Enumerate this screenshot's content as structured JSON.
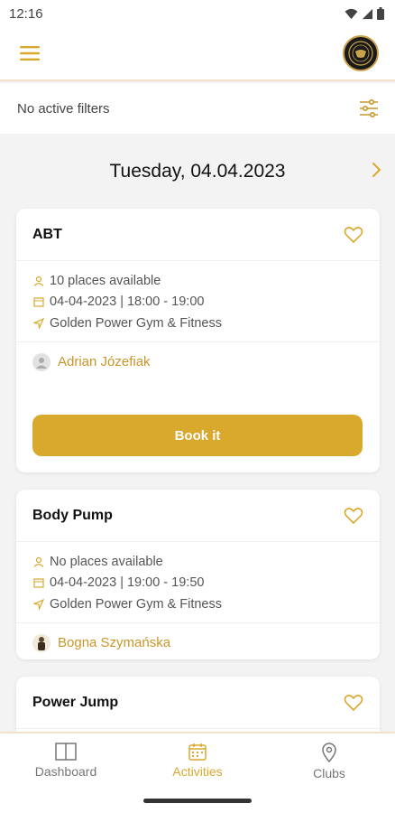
{
  "status": {
    "time": "12:16"
  },
  "filter": {
    "text": "No active filters"
  },
  "date": {
    "label": "Tuesday, 04.04.2023"
  },
  "activities": [
    {
      "title": "ABT",
      "places": "10 places available",
      "datetime": "04-04-2023 | 18:00 - 19:00",
      "location": "Golden Power Gym & Fitness",
      "trainer": "Adrian Józefiak",
      "book_label": "Book it"
    },
    {
      "title": "Body Pump",
      "places": "No places available",
      "datetime": "04-04-2023 | 19:00 - 19:50",
      "location": "Golden Power Gym & Fitness",
      "trainer": "Bogna Szymańska"
    },
    {
      "title": "Power Jump"
    }
  ],
  "nav": {
    "dashboard": "Dashboard",
    "activities": "Activities",
    "clubs": "Clubs"
  },
  "colors": {
    "accent": "#d8a92d",
    "accent_text": "#c9962a",
    "divider": "#f4e2c6"
  },
  "icons": [
    "menu-icon",
    "club-logo",
    "filter-sliders-icon",
    "chevron-right-icon",
    "heart-outline-icon",
    "person-icon",
    "calendar-icon",
    "location-arrow-icon",
    "dashboard-icon",
    "calendar-nav-icon",
    "map-pin-icon"
  ]
}
